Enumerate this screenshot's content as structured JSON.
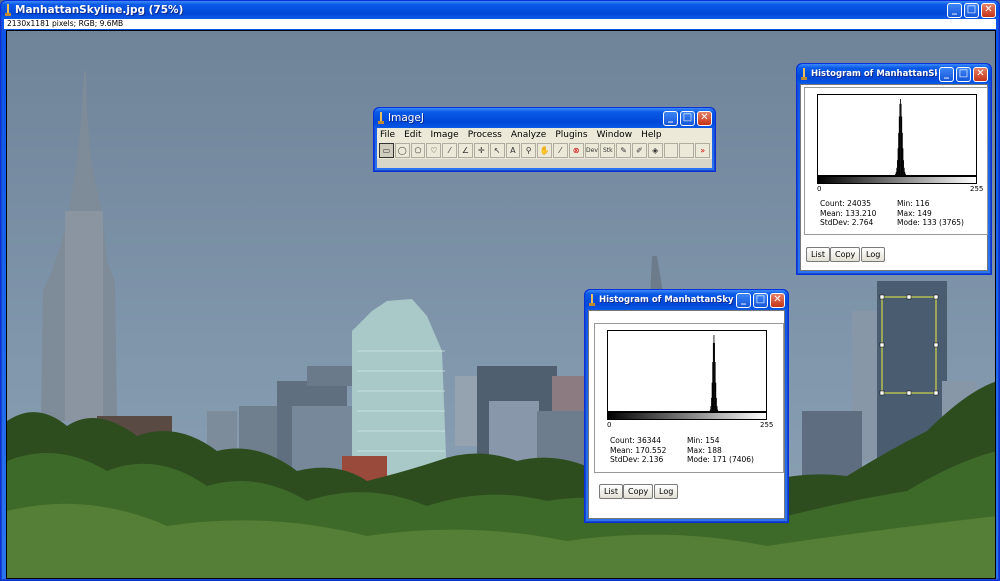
{
  "main_window": {
    "title": "ManhattanSkyline.jpg (75%)",
    "info": "2130x1181 pixels; RGB; 9.6MB"
  },
  "window_buttons": {
    "minimize": "_",
    "maximize": "□",
    "close": "✕"
  },
  "imagej": {
    "title": "ImageJ",
    "menu": [
      "File",
      "Edit",
      "Image",
      "Process",
      "Analyze",
      "Plugins",
      "Window",
      "Help"
    ],
    "tools": [
      {
        "name": "rectangle-tool-icon",
        "glyph": "▭"
      },
      {
        "name": "oval-tool-icon",
        "glyph": "◯"
      },
      {
        "name": "polygon-tool-icon",
        "glyph": "⬠"
      },
      {
        "name": "freehand-tool-icon",
        "glyph": "♡"
      },
      {
        "name": "line-tool-icon",
        "glyph": "⁄"
      },
      {
        "name": "angle-tool-icon",
        "glyph": "∠"
      },
      {
        "name": "point-tool-icon",
        "glyph": "✛"
      },
      {
        "name": "wand-tool-icon",
        "glyph": "↖"
      },
      {
        "name": "text-tool-icon",
        "glyph": "A"
      },
      {
        "name": "magnifier-tool-icon",
        "glyph": "⚲"
      },
      {
        "name": "hand-tool-icon",
        "glyph": "✋"
      },
      {
        "name": "dropper-tool-icon",
        "glyph": "⁄"
      },
      {
        "name": "stop-tool-icon",
        "glyph": "⊗"
      },
      {
        "name": "dev-tool-icon",
        "glyph": "Dev"
      },
      {
        "name": "stk-tool-icon",
        "glyph": "Stk"
      },
      {
        "name": "pencil-tool-icon",
        "glyph": "✎"
      },
      {
        "name": "brush-tool-icon",
        "glyph": "✐"
      },
      {
        "name": "flood-fill-tool-icon",
        "glyph": "◈"
      },
      {
        "name": "empty-tool-slot",
        "glyph": ""
      },
      {
        "name": "empty-tool-slot",
        "glyph": ""
      },
      {
        "name": "more-tools-icon",
        "glyph": "»"
      }
    ]
  },
  "histogram_top": {
    "title": "Histogram of ManhattanSkyline",
    "axis_min": "0",
    "axis_max": "255",
    "stats_left": [
      "Count: 24035",
      "Mean: 133.210",
      "StdDev: 2.764"
    ],
    "stats_right": [
      "Min: 116",
      "Max: 149",
      "Mode: 133 (3765)"
    ],
    "buttons": [
      "List",
      "Copy",
      "Log"
    ],
    "peak": 133,
    "spread": 2.764
  },
  "histogram_bottom": {
    "title": "Histogram of ManhattanSkyline",
    "axis_min": "0",
    "axis_max": "255",
    "stats_left": [
      "Count: 36344",
      "Mean: 170.552",
      "StdDev: 2.136"
    ],
    "stats_right": [
      "Min: 154",
      "Max: 188",
      "Mode: 171 (7406)"
    ],
    "buttons": [
      "List",
      "Copy",
      "Log"
    ],
    "peak": 171,
    "spread": 2.136
  },
  "colors": {
    "titlebar": "#0a5ae8",
    "selection": "#e8f040"
  }
}
